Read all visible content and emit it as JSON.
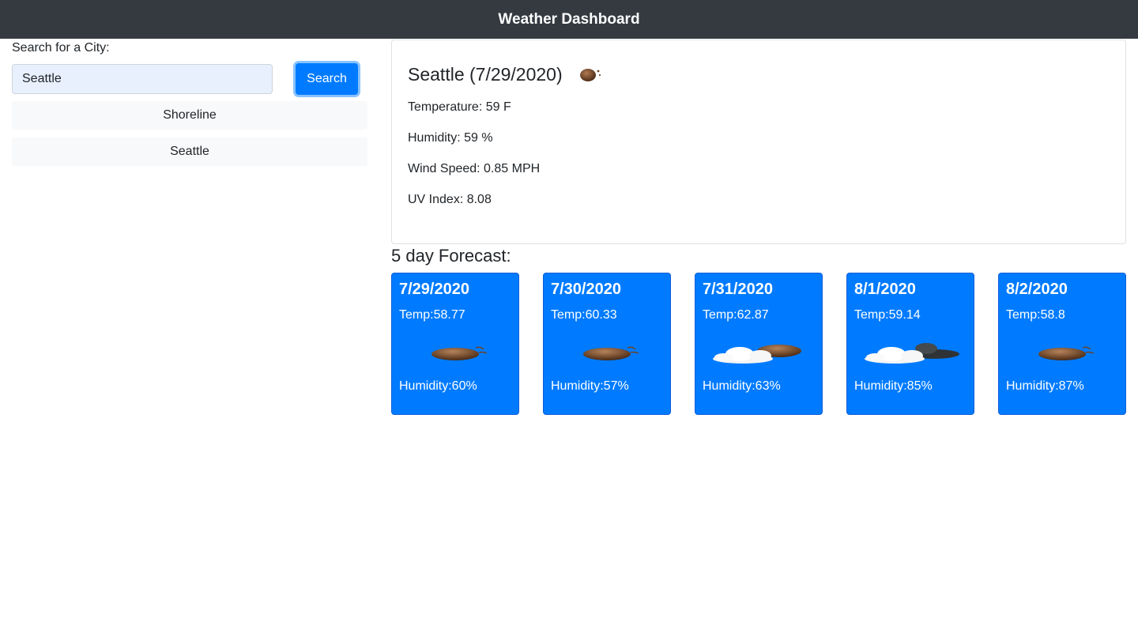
{
  "header": {
    "title": "Weather Dashboard"
  },
  "search": {
    "label": "Search for a City:",
    "value": "Seattle",
    "button_label": "Search"
  },
  "history": [
    {
      "label": "Shoreline"
    },
    {
      "label": "Seattle"
    }
  ],
  "current": {
    "title": "Seattle (7/29/2020)",
    "icon": "clear-night-icon",
    "temperature": "Temperature: 59 F",
    "humidity": "Humidity: 59 %",
    "wind": "Wind Speed: 0.85 MPH",
    "uv": "UV Index: 8.08"
  },
  "forecast": {
    "heading": "5 day Forecast:",
    "days": [
      {
        "date": "7/29/2020",
        "temp": "Temp:58.77",
        "humidity": "Humidity:60%",
        "icon": "clear-night-icon"
      },
      {
        "date": "7/30/2020",
        "temp": "Temp:60.33",
        "humidity": "Humidity:57%",
        "icon": "clear-night-icon"
      },
      {
        "date": "7/31/2020",
        "temp": "Temp:62.87",
        "humidity": "Humidity:63%",
        "icon": "few-clouds-night-icon"
      },
      {
        "date": "8/1/2020",
        "temp": "Temp:59.14",
        "humidity": "Humidity:85%",
        "icon": "broken-clouds-night-icon"
      },
      {
        "date": "8/2/2020",
        "temp": "Temp:58.8",
        "humidity": "Humidity:87%",
        "icon": "clear-night-icon"
      }
    ]
  },
  "colors": {
    "navbar": "#343a40",
    "primary": "#007bff",
    "input_fill": "#e8f0fe",
    "history_bg": "#f8f9fa"
  }
}
